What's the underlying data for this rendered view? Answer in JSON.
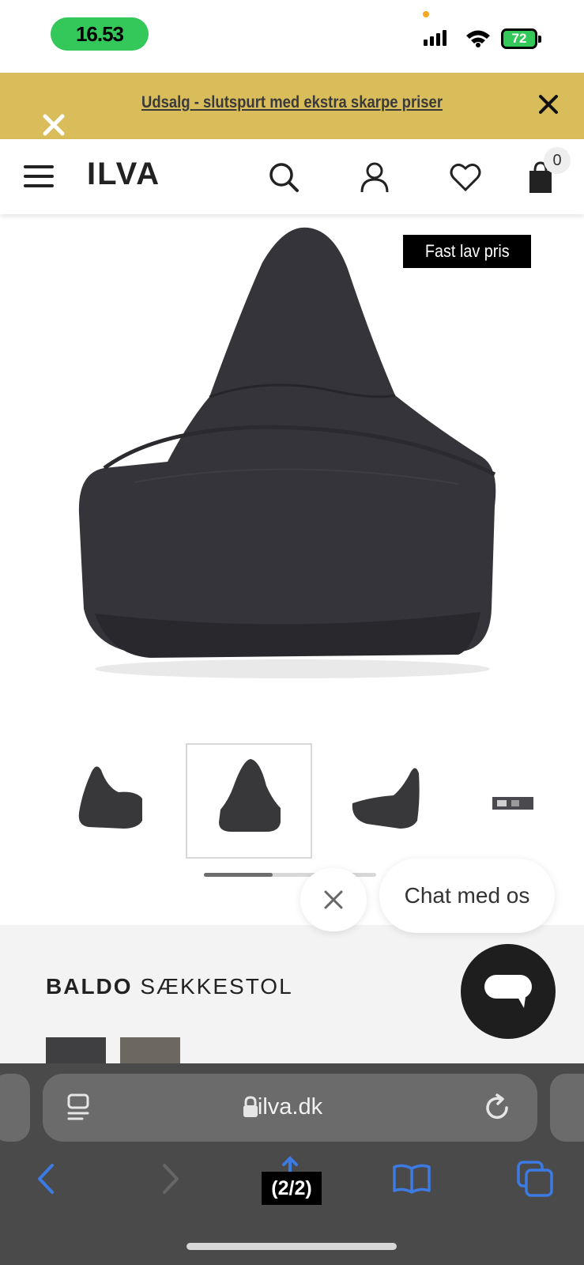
{
  "status_bar": {
    "time": "16.53",
    "battery": "72"
  },
  "promo": {
    "text": "Udsalg - slutspurt med ekstra skarpe priser"
  },
  "header": {
    "logo": "ILVA",
    "cart_count": "0"
  },
  "product": {
    "badge": "Fast lav pris",
    "title_brand": "BALDO",
    "title_type": "SÆKKESTOL",
    "image_index": 2,
    "image_count": 5,
    "swatch_colors": [
      "#3f3f42",
      "#6c6860"
    ]
  },
  "chat": {
    "label": "Chat med os"
  },
  "browser": {
    "url": "ilva.dk",
    "page_counter": "(2/2)"
  },
  "colors": {
    "promo_bg": "#d9bd5a",
    "status_pill": "#34c759",
    "browser_blue": "#3d7be4",
    "chair": "#38383b"
  }
}
